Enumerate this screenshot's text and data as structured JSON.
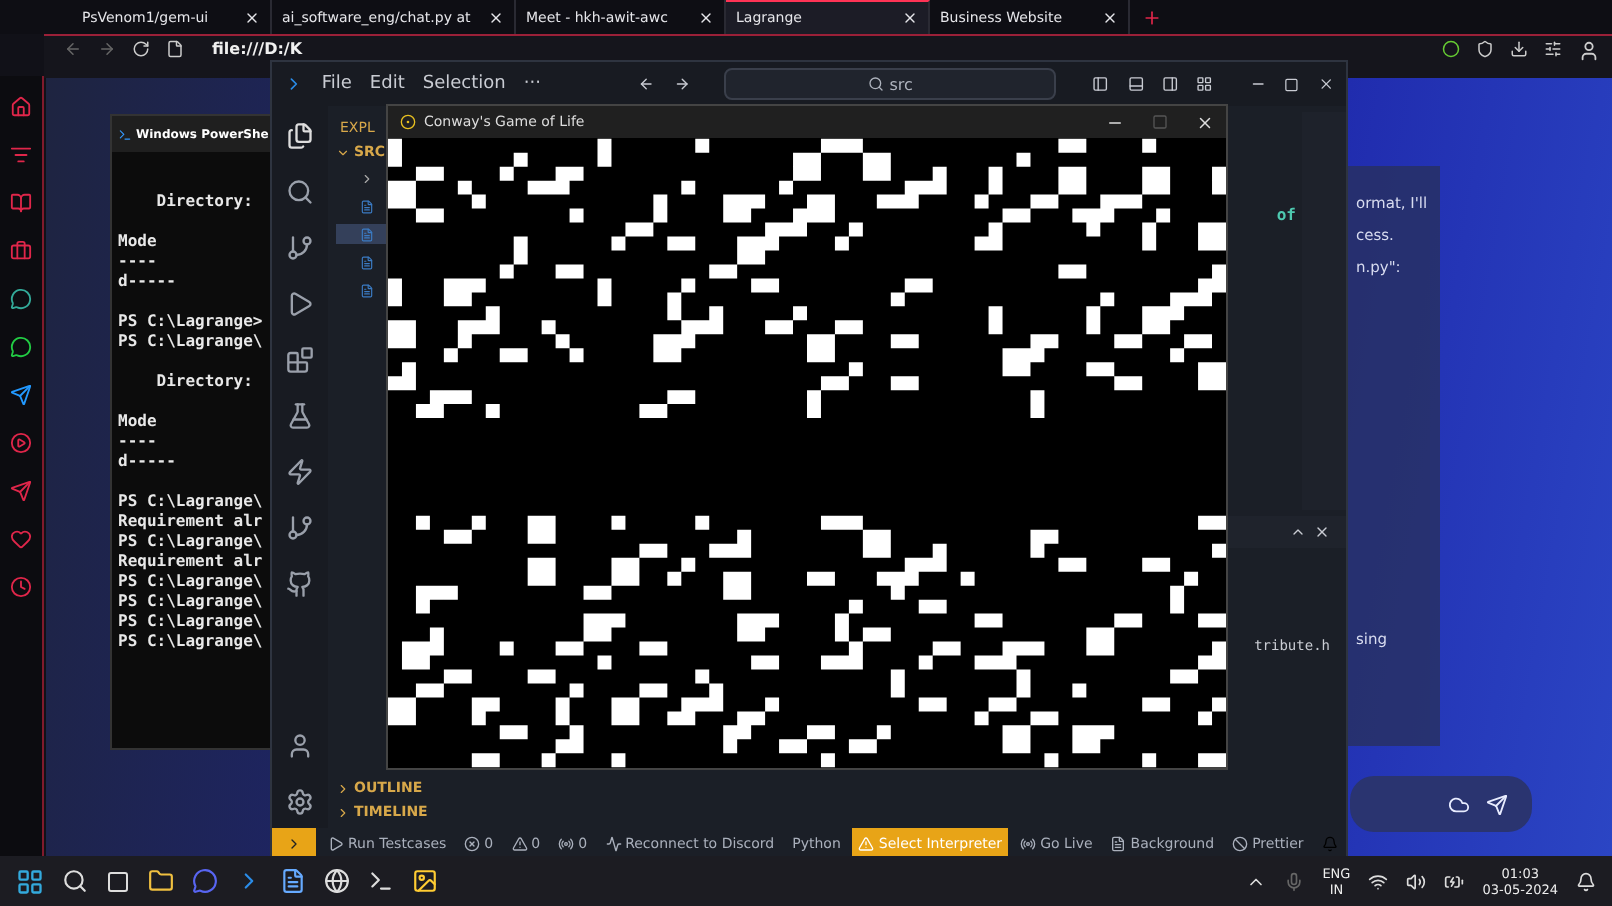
{
  "browser": {
    "tabs": [
      {
        "label": "PsVenom1/gem-ui",
        "selected": false
      },
      {
        "label": "ai_software_eng/chat.py at",
        "selected": false
      },
      {
        "label": "Meet - hkh-awit-awc",
        "selected": false
      },
      {
        "label": "Lagrange",
        "selected": true
      },
      {
        "label": "Business Website",
        "selected": false
      }
    ],
    "address": "file:///D:/K"
  },
  "powershell": {
    "title": "Windows PowerShe",
    "blocks": [
      [
        "    Directory:"
      ],
      [
        "Mode",
        "----",
        "d-----"
      ],
      [
        "PS C:\\Lagrange>",
        "PS C:\\Lagrange\\"
      ],
      [
        "    Directory:"
      ],
      [
        "Mode",
        "----",
        "d-----"
      ],
      [
        "PS C:\\Lagrange\\",
        "Requirement alr",
        "PS C:\\Lagrange\\",
        "Requirement alr",
        "PS C:\\Lagrange\\",
        "PS C:\\Lagrange\\",
        "PS C:\\Lagrange\\",
        "PS C:\\Lagrange\\"
      ]
    ]
  },
  "vscode": {
    "menu": [
      "File",
      "Edit",
      "Selection",
      "···"
    ],
    "search": "src",
    "explorer_label": "EXPL",
    "folder": "SRC",
    "editor_text": "of",
    "terminal_text": "tribute.h",
    "sections": [
      "OUTLINE",
      "TIMELINE"
    ],
    "status_items": [
      {
        "label": "Run Testcases",
        "highlighted": false
      },
      {
        "label": "0",
        "highlighted": false
      },
      {
        "label": "0",
        "highlighted": false
      },
      {
        "label": "0",
        "highlighted": false
      },
      {
        "label": "Reconnect to Discord",
        "highlighted": false
      },
      {
        "label": "Python",
        "highlighted": false
      },
      {
        "label": "Select Interpreter",
        "highlighted": true
      },
      {
        "label": "Go Live",
        "highlighted": false
      },
      {
        "label": "Background",
        "highlighted": false
      },
      {
        "label": "Prettier",
        "highlighted": false
      }
    ]
  },
  "game_window": {
    "title": "Conway's Game of Life"
  },
  "chat": {
    "lines": [
      "ormat, I'll",
      "cess.",
      "n.py\":",
      "sing"
    ]
  },
  "taskbar": {
    "language": "ENG",
    "region": "IN",
    "time": "01:03",
    "date": "03-05-2024"
  }
}
